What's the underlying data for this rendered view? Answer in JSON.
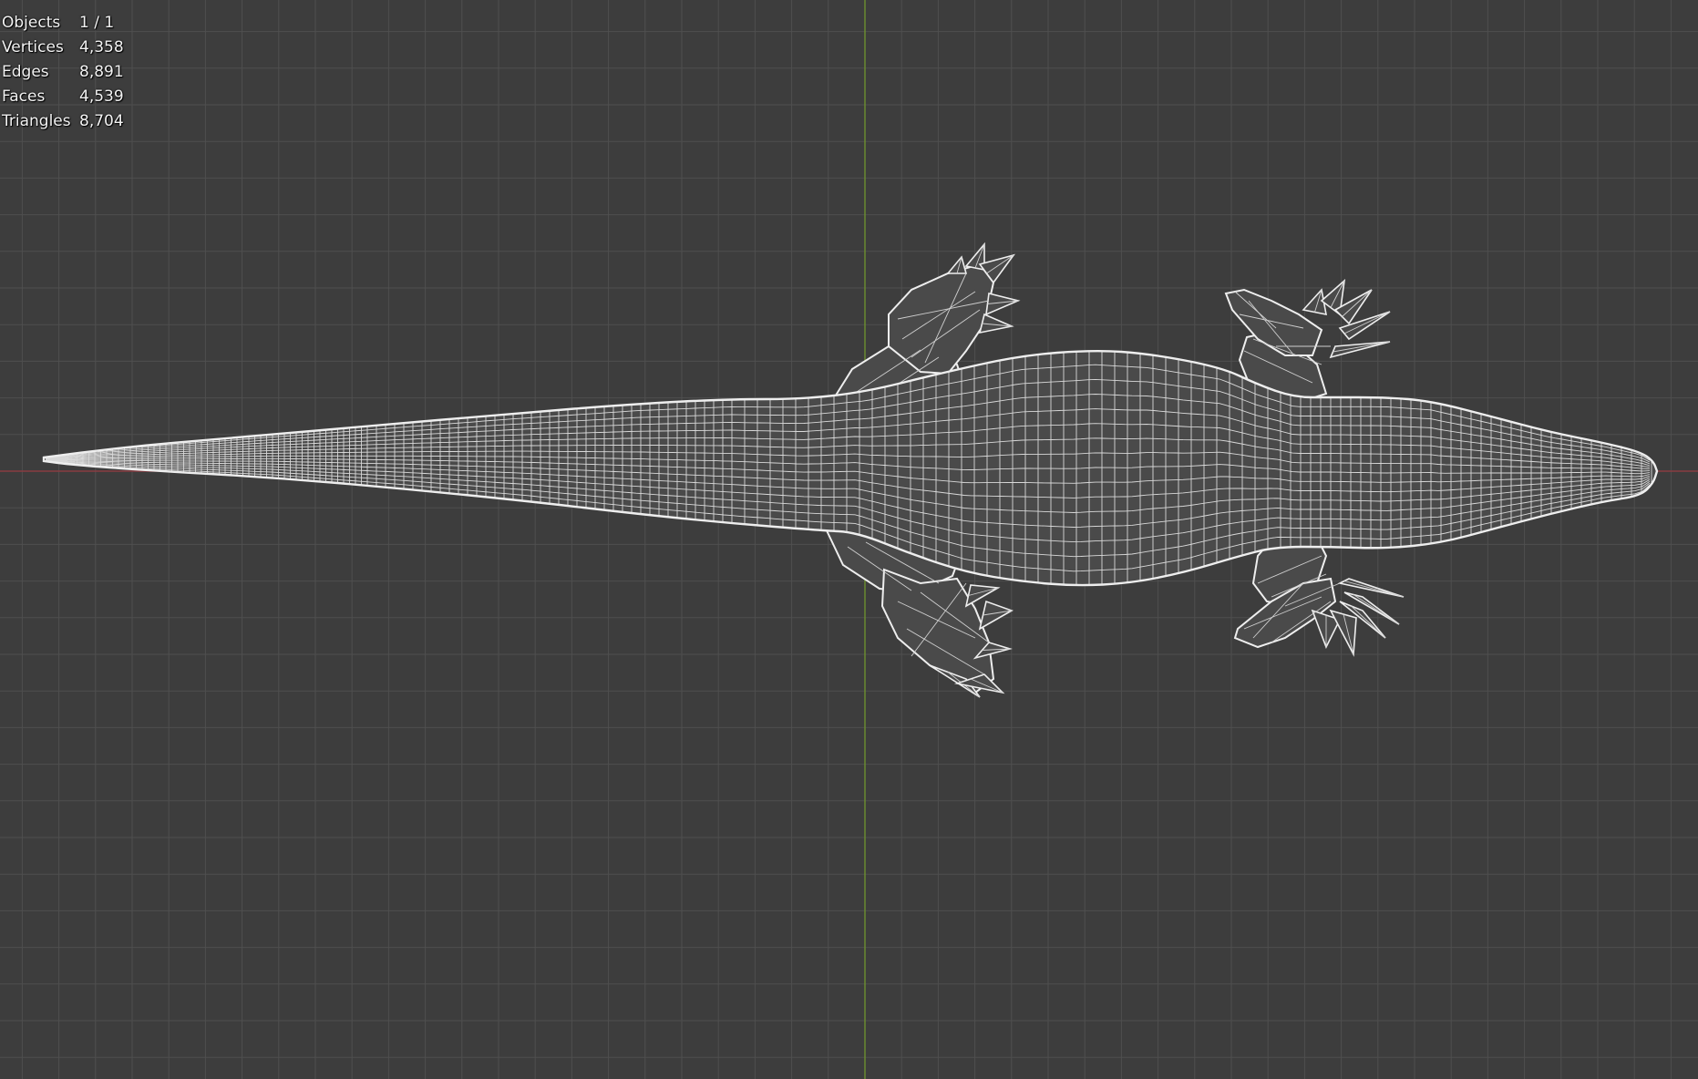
{
  "viewport": {
    "background": "#3d3d3d",
    "grid_color": "#4f4f4f",
    "x_axis_color": "#8a3c42",
    "y_axis_color": "#6a8a30",
    "wire_color": "#eeeeee",
    "mesh_fill": "#4a4a4a",
    "display_mode": "wireframe",
    "view": "top orthographic",
    "object_description": "lizard"
  },
  "stats": [
    {
      "label": "Objects",
      "value": "1 / 1"
    },
    {
      "label": "Vertices",
      "value": "4,358"
    },
    {
      "label": "Edges",
      "value": "8,891"
    },
    {
      "label": "Faces",
      "value": "4,539"
    },
    {
      "label": "Triangles",
      "value": "8,704"
    }
  ]
}
